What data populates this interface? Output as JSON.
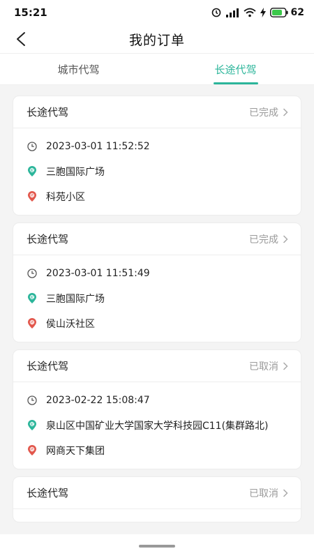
{
  "status_bar": {
    "time": "15:21",
    "battery": "62",
    "icons": [
      "alarm-icon",
      "signal-icon",
      "wifi-icon",
      "charging-icon",
      "battery-icon"
    ]
  },
  "header": {
    "title": "我的订单"
  },
  "tabs": [
    {
      "label": "城市代驾",
      "active": false
    },
    {
      "label": "长途代驾",
      "active": true
    }
  ],
  "accent_color": "#2bb59a",
  "orders": [
    {
      "type": "长途代驾",
      "status": "已完成",
      "time": "2023-03-01 11:52:52",
      "from": "三胞国际广场",
      "to": "科苑小区"
    },
    {
      "type": "长途代驾",
      "status": "已完成",
      "time": "2023-03-01 11:51:49",
      "from": "三胞国际广场",
      "to": "侯山沃社区"
    },
    {
      "type": "长途代驾",
      "status": "已取消",
      "time": "2023-02-22 15:08:47",
      "from": "泉山区中国矿业大学国家大学科技园C11(集群路北)",
      "to": "网商天下集团"
    },
    {
      "type": "长途代驾",
      "status": "已取消"
    }
  ]
}
